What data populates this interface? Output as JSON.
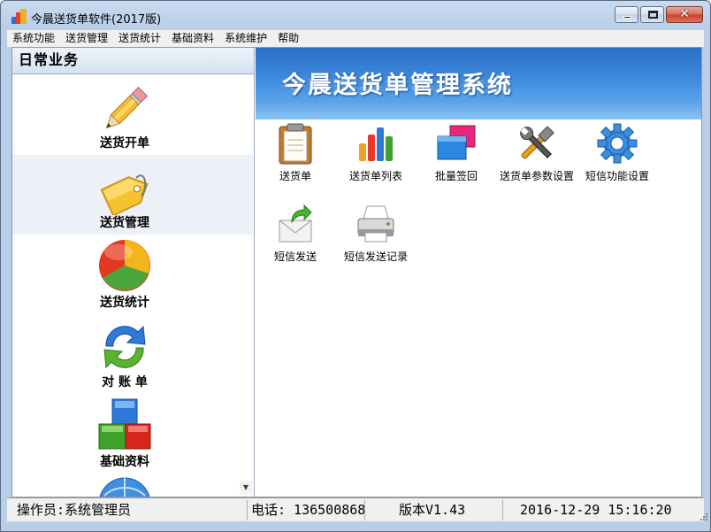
{
  "window": {
    "title": "今晨送货单软件(2017版)",
    "close_glyph": "✕"
  },
  "menubar": {
    "items": [
      "系统功能",
      "送货管理",
      "送货统计",
      "基础资料",
      "系统维护",
      "帮助"
    ]
  },
  "left_panel": {
    "header": "日常业务",
    "items": [
      {
        "label": "送货开单",
        "icon": "pencil-icon"
      },
      {
        "label": "送货管理",
        "icon": "tag-icon"
      },
      {
        "label": "送货统计",
        "icon": "pie-chart-icon"
      },
      {
        "label": "对 账 单",
        "icon": "refresh-arrows-icon"
      },
      {
        "label": "基础资料",
        "icon": "blocks-icon"
      }
    ],
    "scroll_glyph": "▼"
  },
  "banner": {
    "title": "今晨送货单管理系统"
  },
  "functions": [
    {
      "label": "送货单",
      "icon": "clipboard-icon"
    },
    {
      "label": "送货单列表",
      "icon": "bar-chart-icon"
    },
    {
      "label": "批量签回",
      "icon": "windows-icon"
    },
    {
      "label": "送货单参数设置",
      "icon": "tools-icon"
    },
    {
      "label": "短信功能设置",
      "icon": "gear-icon"
    },
    {
      "label": "短信发送",
      "icon": "envelope-send-icon"
    },
    {
      "label": "短信发送记录",
      "icon": "printer-icon"
    }
  ],
  "statusbar": {
    "operator": "操作员:系统管理员",
    "phone": "电话: 136500868",
    "version": "版本V1.43",
    "datetime": "2016-12-29 15:16:20"
  }
}
